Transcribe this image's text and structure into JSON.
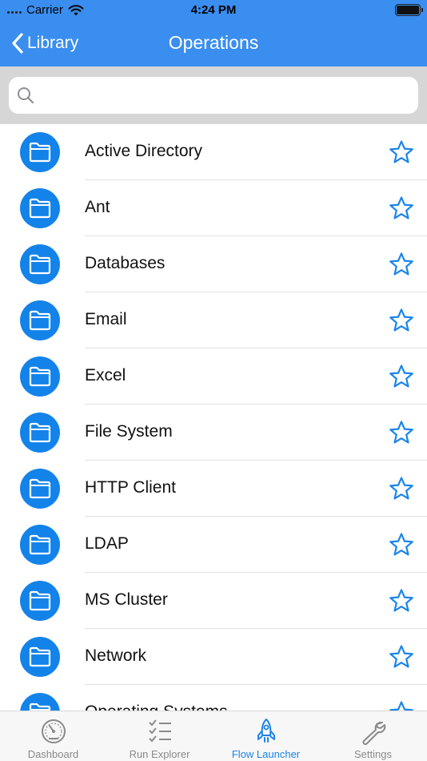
{
  "status_bar": {
    "carrier": "Carrier",
    "time": "4:24 PM",
    "battery_level": 1.0
  },
  "nav": {
    "back_label": "Library",
    "title": "Operations",
    "back_icon": "chevron-left-icon"
  },
  "search": {
    "placeholder": "",
    "value": "",
    "icon": "search-icon"
  },
  "list": {
    "items": [
      {
        "label": "Active Directory",
        "favorite": false
      },
      {
        "label": "Ant",
        "favorite": false
      },
      {
        "label": "Databases",
        "favorite": false
      },
      {
        "label": "Email",
        "favorite": false
      },
      {
        "label": "Excel",
        "favorite": false
      },
      {
        "label": "File System",
        "favorite": false
      },
      {
        "label": "HTTP Client",
        "favorite": false
      },
      {
        "label": "LDAP",
        "favorite": false
      },
      {
        "label": "MS Cluster",
        "favorite": false
      },
      {
        "label": "Network",
        "favorite": false
      },
      {
        "label": "Operating Systems",
        "favorite": false
      }
    ]
  },
  "tabbar": {
    "tabs": [
      {
        "label": "Dashboard",
        "icon": "gauge-icon",
        "active": false
      },
      {
        "label": "Run Explorer",
        "icon": "checklist-icon",
        "active": false
      },
      {
        "label": "Flow Launcher",
        "icon": "rocket-icon",
        "active": true
      },
      {
        "label": "Settings",
        "icon": "wrench-icon",
        "active": false
      }
    ]
  },
  "colors": {
    "nav_background": "#3a8ef0",
    "accent": "#1a84ea",
    "folder_badge": "#1383ea",
    "search_background": "#d6d6d6"
  }
}
